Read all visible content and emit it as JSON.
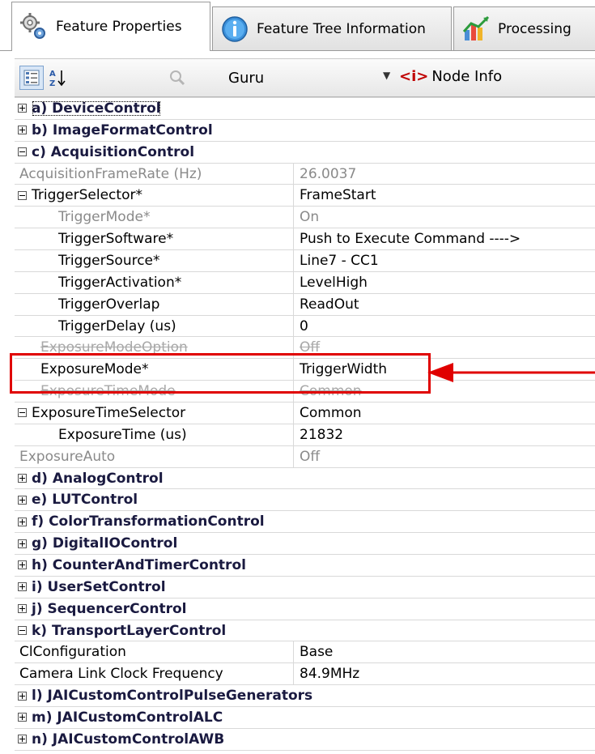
{
  "tabs": [
    {
      "label": "Feature Properties",
      "icon": "gears-icon",
      "active": true
    },
    {
      "label": "Feature Tree Information",
      "icon": "info-icon",
      "active": false
    },
    {
      "label": "Processing",
      "icon": "chart-icon",
      "active": false
    }
  ],
  "toolbar": {
    "categorized_icon": "categorized-view-icon",
    "sort_icon": "sort-az-icon",
    "search_icon": "search-icon",
    "visibility_value": "Guru",
    "node_info_icon_text": "<i>",
    "node_info_label": "Node Info"
  },
  "properties": [
    {
      "kind": "category",
      "expander": "plus",
      "name": "a) DeviceControl"
    },
    {
      "kind": "category",
      "expander": "plus",
      "name": "b) ImageFormatControl"
    },
    {
      "kind": "category",
      "expander": "minus",
      "name": "c) AcquisitionControl"
    },
    {
      "kind": "property",
      "state": "disabled",
      "level": 1,
      "name": "AcquisitionFrameRate (Hz)",
      "value": "26.0037"
    },
    {
      "kind": "property",
      "state": "normal",
      "level": 1,
      "expander": "minus",
      "name": "TriggerSelector*",
      "value": "FrameStart"
    },
    {
      "kind": "property",
      "state": "disabled",
      "level": 3,
      "name": "TriggerMode*",
      "value": "On"
    },
    {
      "kind": "property",
      "state": "normal",
      "level": 3,
      "name": "TriggerSoftware*",
      "value": "Push to Execute Command ---->"
    },
    {
      "kind": "property",
      "state": "normal",
      "level": 3,
      "name": "TriggerSource*",
      "value": "Line7 - CC1"
    },
    {
      "kind": "property",
      "state": "normal",
      "level": 3,
      "name": "TriggerActivation*",
      "value": "LevelHigh"
    },
    {
      "kind": "property",
      "state": "normal",
      "level": 3,
      "name": "TriggerOverlap",
      "value": "ReadOut"
    },
    {
      "kind": "property",
      "state": "normal",
      "level": 3,
      "name": "TriggerDelay (us)",
      "value": "0"
    },
    {
      "kind": "property",
      "state": "struck",
      "level": 2,
      "name": "ExposureModeOption",
      "value": "Off"
    },
    {
      "kind": "property",
      "state": "normal",
      "level": 2,
      "name": "ExposureMode*",
      "value": "TriggerWidth"
    },
    {
      "kind": "property",
      "state": "struck",
      "level": 2,
      "name": "ExposureTimeMode",
      "value": "Common"
    },
    {
      "kind": "property",
      "state": "normal",
      "level": 1,
      "expander": "minus",
      "name": "ExposureTimeSelector",
      "value": "Common"
    },
    {
      "kind": "property",
      "state": "normal",
      "level": 3,
      "name": "ExposureTime (us)",
      "value": "21832"
    },
    {
      "kind": "property",
      "state": "disabled",
      "level": 1,
      "name": "ExposureAuto",
      "value": "Off"
    },
    {
      "kind": "category",
      "expander": "plus",
      "name": "d) AnalogControl"
    },
    {
      "kind": "category",
      "expander": "plus",
      "name": "e) LUTControl"
    },
    {
      "kind": "category",
      "expander": "plus",
      "name": "f) ColorTransformationControl"
    },
    {
      "kind": "category",
      "expander": "plus",
      "name": "g) DigitalIOControl"
    },
    {
      "kind": "category",
      "expander": "plus",
      "name": "h) CounterAndTimerControl"
    },
    {
      "kind": "category",
      "expander": "plus",
      "name": "i) UserSetControl"
    },
    {
      "kind": "category",
      "expander": "plus",
      "name": "j) SequencerControl"
    },
    {
      "kind": "category",
      "expander": "minus",
      "name": "k) TransportLayerControl"
    },
    {
      "kind": "property",
      "state": "normal",
      "level": 1,
      "name": "ClConfiguration",
      "value": "Base"
    },
    {
      "kind": "property",
      "state": "normal",
      "level": 1,
      "name": "Camera Link Clock Frequency",
      "value": "84.9MHz"
    },
    {
      "kind": "category",
      "expander": "plus",
      "name": "l) JAICustomControlPulseGenerators"
    },
    {
      "kind": "category",
      "expander": "plus",
      "name": "m) JAICustomControlALC"
    },
    {
      "kind": "category",
      "expander": "plus",
      "name": "n) JAICustomControlAWB"
    }
  ],
  "annotation": {
    "highlighted_property": "ExposureMode*",
    "color": "#e00000"
  },
  "colors": {
    "category_text": "#1a1a40",
    "disabled_text": "#8a8a8a",
    "grid_line": "#d9d9d9"
  }
}
